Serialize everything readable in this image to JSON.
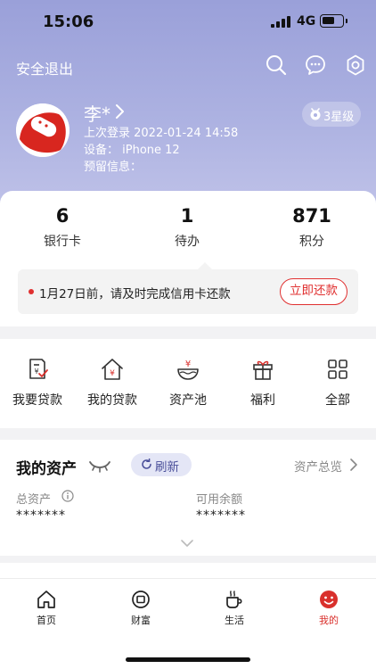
{
  "status_bar": {
    "time": "15:06",
    "network": "4G"
  },
  "header": {
    "logout_label": "安全退出"
  },
  "profile": {
    "name": "李*",
    "last_login": "上次登录  2022-01-24 14:58",
    "device": "设备：  iPhone 12",
    "reserved_info": "预留信息：",
    "level": "3星级"
  },
  "stats": [
    {
      "value": "6",
      "label": "银行卡"
    },
    {
      "value": "1",
      "label": "待办"
    },
    {
      "value": "871",
      "label": "积分"
    }
  ],
  "notice": {
    "text": "1月27日前，请及时完成信用卡还款",
    "button": "立即还款"
  },
  "menu": [
    {
      "label": "我要贷款",
      "icon": "loan-apply-icon"
    },
    {
      "label": "我的贷款",
      "icon": "my-loan-icon"
    },
    {
      "label": "资产池",
      "icon": "asset-pool-icon"
    },
    {
      "label": "福利",
      "icon": "gift-icon"
    },
    {
      "label": "全部",
      "icon": "grid-icon"
    }
  ],
  "assets": {
    "title": "我的资产",
    "refresh_label": "刷新",
    "overview_label": "资产总览",
    "total_label": "总资产",
    "total_value": "*******",
    "available_label": "可用余额",
    "available_value": "*******"
  },
  "tabs": [
    {
      "label": "首页",
      "icon": "home-icon",
      "active": false
    },
    {
      "label": "财富",
      "icon": "wealth-icon",
      "active": false
    },
    {
      "label": "生活",
      "icon": "coffee-icon",
      "active": false
    },
    {
      "label": "我的",
      "icon": "profile-face-icon",
      "active": true
    }
  ],
  "colors": {
    "accent_red": "#e03030",
    "header_purple": "#9aa0d9",
    "refresh_text": "#4a4f9a"
  }
}
